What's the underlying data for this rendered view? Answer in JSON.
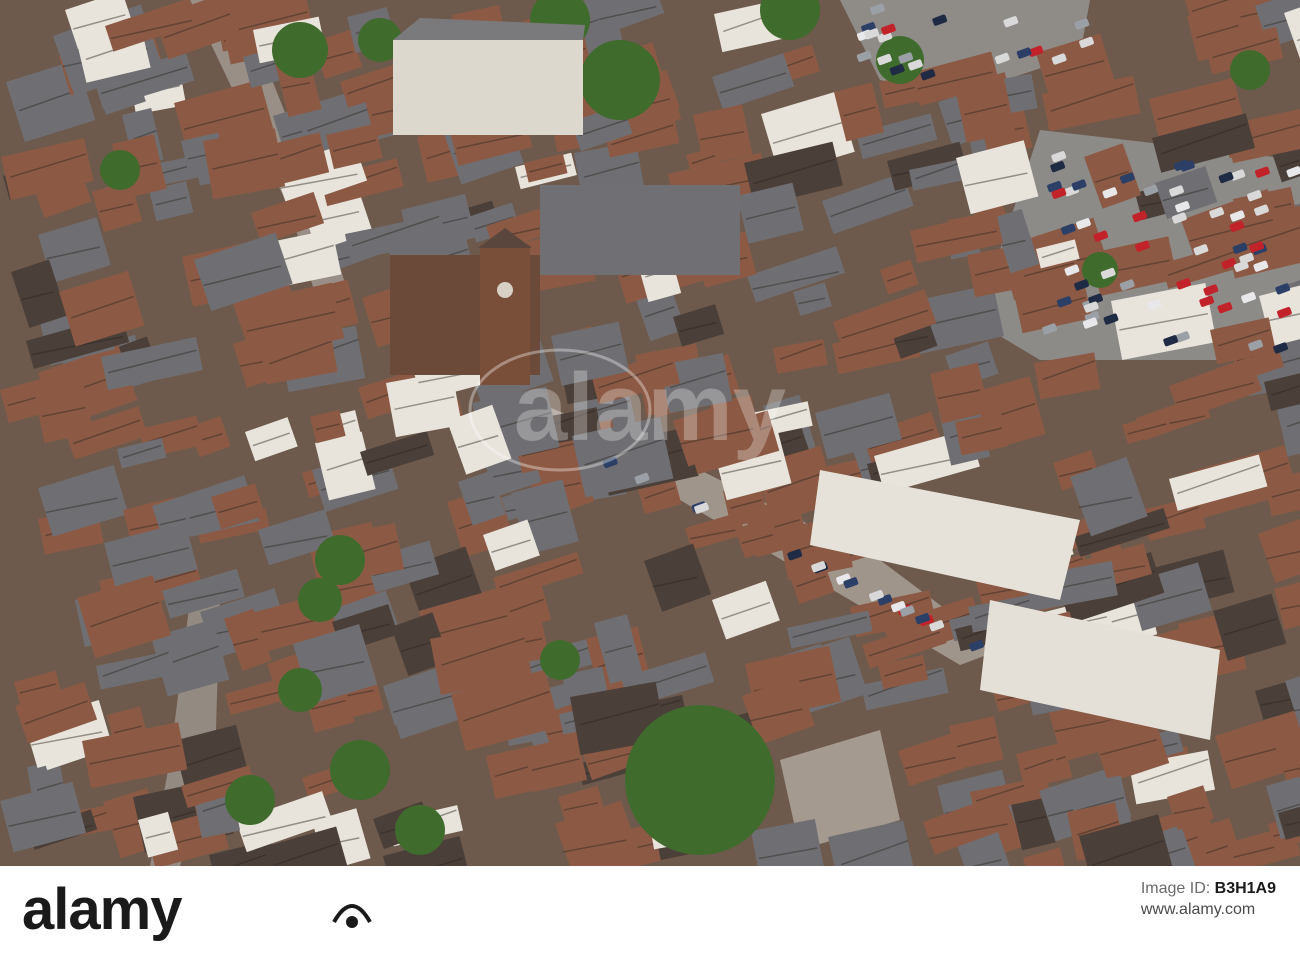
{
  "photo": {
    "description_icon": "aerial-town-photo",
    "palette": {
      "roof_slate": "#6f6f73",
      "roof_tile": "#8c5a44",
      "roof_dark": "#4b3f39",
      "wall_white": "#e8e4dc",
      "street": "#9a8f86",
      "parking": "#8d8b88",
      "tree": "#3f6b2c",
      "shadow": "#2c2622"
    }
  },
  "watermark": {
    "text": "alamy"
  },
  "footer": {
    "brand": "alamy",
    "image_id_label": "Image ID:",
    "image_id": "B3H1A9",
    "site": "www.alamy.com"
  }
}
